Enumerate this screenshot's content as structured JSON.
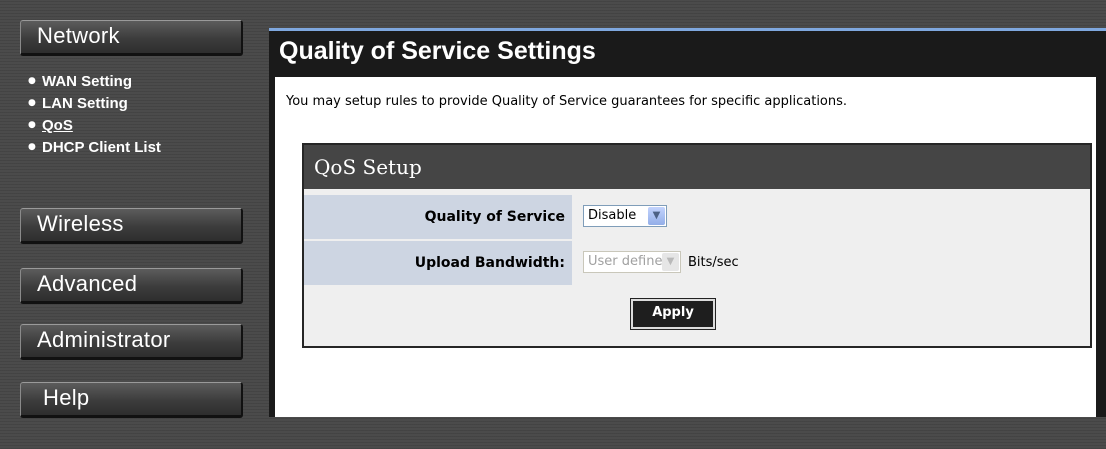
{
  "sidebar": {
    "sections": {
      "network": "Network",
      "wireless": "Wireless",
      "advanced": "Advanced",
      "administrator": "Administrator",
      "help": "Help"
    },
    "network_items": [
      "WAN Setting",
      "LAN Setting",
      "QoS",
      "DHCP Client List"
    ],
    "active_item": "QoS"
  },
  "main": {
    "title": "Quality of Service Settings",
    "intro": "You may setup rules to provide Quality of Service guarantees for specific applications.",
    "qos_setup": {
      "header": "QoS Setup",
      "qos_label": "Quality of Service",
      "qos_value": "Disable",
      "bandwidth_label": "Upload Bandwidth:",
      "bandwidth_value": "User defined",
      "bandwidth_unit": "Bits/sec",
      "apply_label": "Apply"
    }
  },
  "colors": {
    "accent_line": "#7fa8df",
    "label_bg": "#cdd5e2",
    "panel_header": "#454545"
  },
  "icons": {
    "bullet": "bullet-icon",
    "dropdown": "chevron-down-icon"
  }
}
